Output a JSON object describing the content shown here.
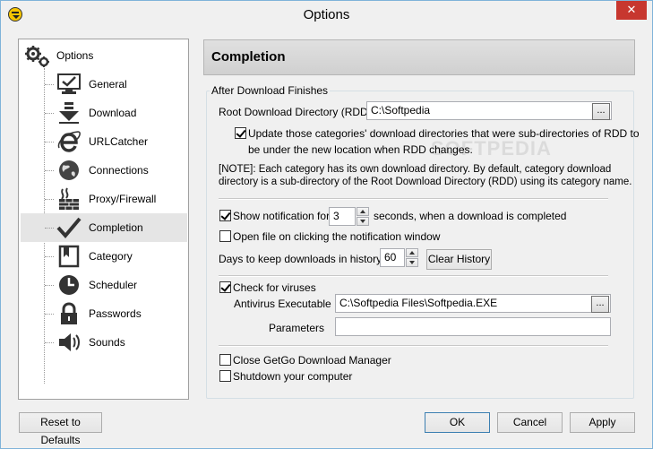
{
  "window": {
    "title": "Options",
    "close_glyph": "✕"
  },
  "tree": {
    "root": {
      "label": "Options",
      "icon": "gears-icon"
    },
    "items": [
      {
        "label": "General",
        "icon": "monitor-check-icon"
      },
      {
        "label": "Download",
        "icon": "download-arrow-icon"
      },
      {
        "label": "URLCatcher",
        "icon": "ie-e-icon"
      },
      {
        "label": "Connections",
        "icon": "globe-icon"
      },
      {
        "label": "Proxy/Firewall",
        "icon": "firewall-icon"
      },
      {
        "label": "Completion",
        "icon": "checkmark-icon",
        "selected": true
      },
      {
        "label": "Category",
        "icon": "category-book-icon"
      },
      {
        "label": "Scheduler",
        "icon": "clock-icon"
      },
      {
        "label": "Passwords",
        "icon": "padlock-icon"
      },
      {
        "label": "Sounds",
        "icon": "speaker-icon"
      }
    ]
  },
  "content": {
    "header": "Completion",
    "group_title": "After Download Finishes",
    "rdd_label": "Root Download Directory (RDD):",
    "rdd_value": "C:\\Softpedia",
    "browse_label": "...",
    "update_subdirs_line1": "Update those categories' download directories that were sub-directories of RDD to",
    "update_subdirs_line2": "be under the new location when RDD changes.",
    "update_subdirs_checked": true,
    "note_line1": "[NOTE]: Each category has its own download directory.  By default, category download",
    "note_line2": "directory is a sub-directory of the Root Download Directory (RDD) using its category name.",
    "show_notification_label": "Show notification for",
    "show_notification_checked": true,
    "notification_seconds": "3",
    "notification_suffix": "seconds, when a download is completed",
    "open_file_label": "Open file on clicking the notification window",
    "open_file_checked": false,
    "history_label": "Days to keep downloads in history:",
    "history_days": "60",
    "clear_history_label": "Clear History",
    "check_viruses_label": "Check for viruses",
    "check_viruses_checked": true,
    "antivirus_label": "Antivirus Executable",
    "antivirus_value": "C:\\Softpedia Files\\Softpedia.EXE",
    "parameters_label": "Parameters",
    "parameters_value": "",
    "close_getgo_label": "Close GetGo Download Manager",
    "close_getgo_checked": false,
    "shutdown_label": "Shutdown your computer",
    "shutdown_checked": false
  },
  "footer": {
    "reset_label": "Reset to Defaults",
    "ok_label": "OK",
    "cancel_label": "Cancel",
    "apply_label": "Apply"
  }
}
